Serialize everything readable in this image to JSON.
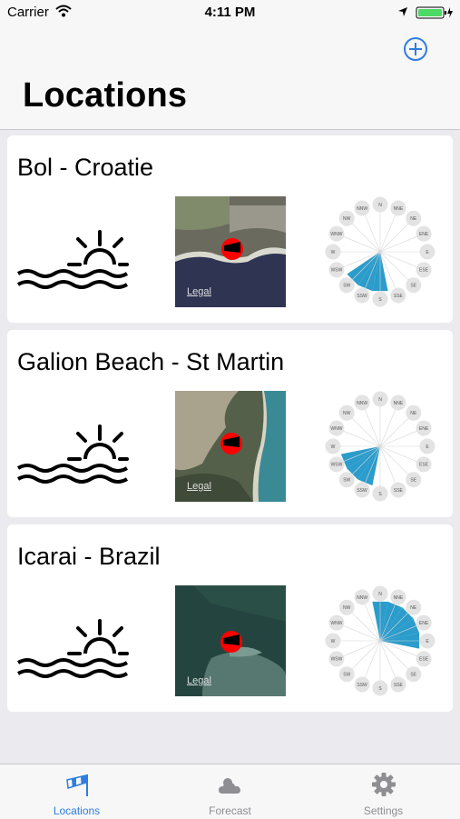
{
  "status": {
    "carrier": "Carrier",
    "time": "4:11 PM"
  },
  "nav": {
    "title": "Locations"
  },
  "locations": [
    {
      "name": "Bol - Croatie",
      "legal": "Legal"
    },
    {
      "name": "Galion Beach - St Martin",
      "legal": "Legal"
    },
    {
      "name": "Icarai - Brazil",
      "legal": "Legal"
    }
  ],
  "compass": [
    "N",
    "NNE",
    "NE",
    "ENE",
    "E",
    "ESE",
    "SE",
    "SSE",
    "S",
    "SSW",
    "SW",
    "WSW",
    "W",
    "WNW",
    "NW",
    "NNW"
  ],
  "tabs": [
    {
      "label": "Locations"
    },
    {
      "label": "Forecast"
    },
    {
      "label": "Settings"
    }
  ],
  "colors": {
    "accent": "#2f7de1",
    "wind": "#2b9ccb",
    "marker": "#ff0000",
    "battery": "#4cd964"
  }
}
